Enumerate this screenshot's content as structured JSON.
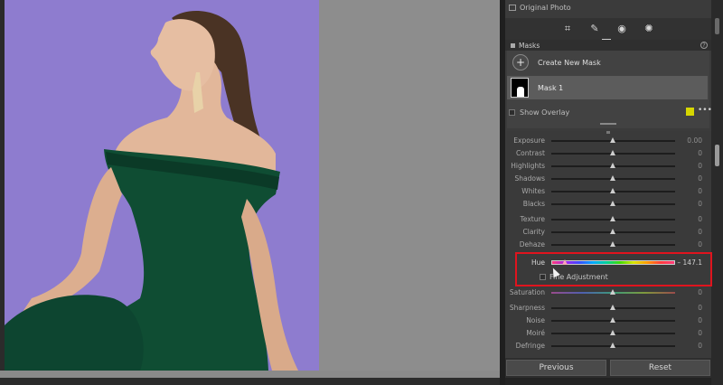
{
  "panel": {
    "original_photo_label": "Original Photo",
    "masks_title": "Masks",
    "help_glyph": "?",
    "create_mask_label": "Create New Mask",
    "plus_glyph": "+",
    "mask_name": "Mask 1",
    "show_overlay_label": "Show Overlay",
    "overlay_color": "#d6d600",
    "more_glyph": "•••",
    "tools": [
      {
        "name": "crop-tool-icon",
        "glyph": "⌗"
      },
      {
        "name": "healing-tool-icon",
        "glyph": "✎"
      },
      {
        "name": "red-eye-tool-icon",
        "glyph": "◉"
      },
      {
        "name": "masking-tool-icon",
        "glyph": "✺"
      }
    ]
  },
  "sliders": {
    "exposure": {
      "label": "Exposure",
      "value": "0.00",
      "position": 0.5
    },
    "contrast": {
      "label": "Contrast",
      "value": "0",
      "position": 0.5
    },
    "highlights": {
      "label": "Highlights",
      "value": "0",
      "position": 0.5
    },
    "shadows": {
      "label": "Shadows",
      "value": "0",
      "position": 0.5
    },
    "whites": {
      "label": "Whites",
      "value": "0",
      "position": 0.5
    },
    "blacks": {
      "label": "Blacks",
      "value": "0",
      "position": 0.5
    },
    "texture": {
      "label": "Texture",
      "value": "0",
      "position": 0.5
    },
    "clarity": {
      "label": "Clarity",
      "value": "0",
      "position": 0.5
    },
    "dehaze": {
      "label": "Dehaze",
      "value": "0",
      "position": 0.5
    },
    "hue": {
      "label": "Hue",
      "value": "– 147.1",
      "position": 0.11
    },
    "fine_adjustment_label": "Fine Adjustment",
    "saturation": {
      "label": "Saturation",
      "value": "0",
      "position": 0.5
    },
    "sharpness": {
      "label": "Sharpness",
      "value": "0",
      "position": 0.5
    },
    "noise": {
      "label": "Noise",
      "value": "0",
      "position": 0.5
    },
    "moire": {
      "label": "Moiré",
      "value": "0",
      "position": 0.5
    },
    "defringe": {
      "label": "Defringe",
      "value": "0",
      "position": 0.5
    }
  },
  "buttons": {
    "previous": "Previous",
    "reset": "Reset"
  },
  "colors": {
    "highlight_box": "#e0141e",
    "photo_backdrop": "#8e7ccf",
    "dress": "#0f4d33"
  }
}
